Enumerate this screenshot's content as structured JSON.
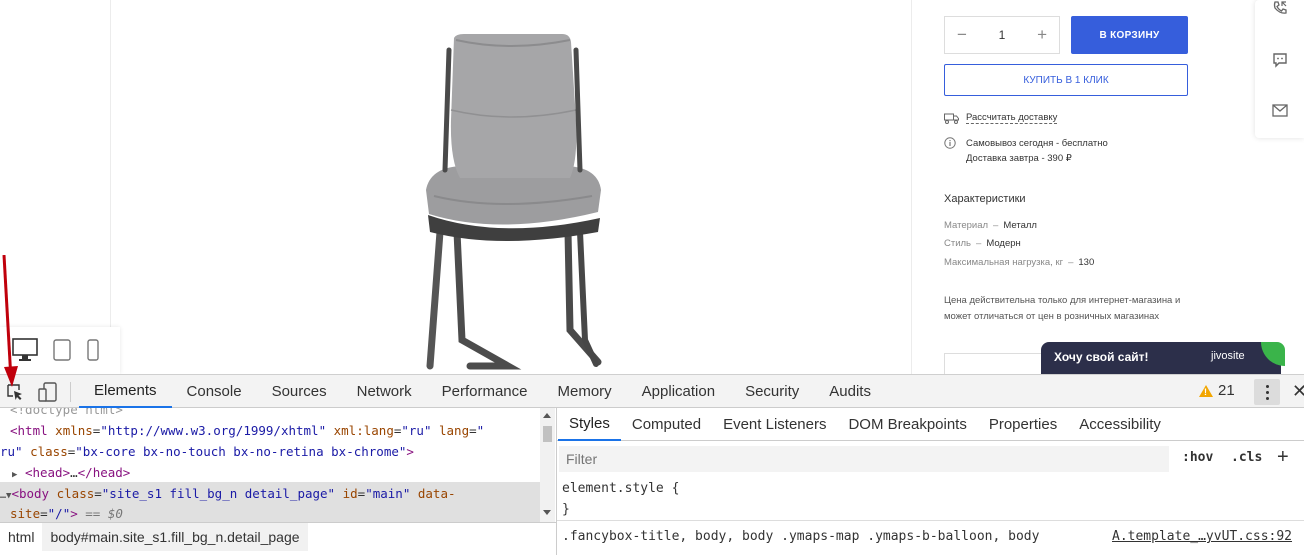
{
  "shop": {
    "quantity": {
      "minus": "−",
      "value": "1",
      "plus": "+"
    },
    "add_to_cart": "В КОРЗИНУ",
    "buy_one_click": "КУПИТЬ В 1 КЛИК",
    "delivery_calc": "Рассчитать доставку",
    "pickup": "Самовывоз сегодня - бесплатно",
    "delivery_tomorrow": "Доставка завтра - 390 ₽",
    "characteristics_title": "Характеристики",
    "characteristics": [
      {
        "key": "Материал",
        "dash": "–",
        "value": "Металл"
      },
      {
        "key": "Стиль",
        "dash": "–",
        "value": "Модерн"
      },
      {
        "key": "Максимальная нагрузка, кг",
        "dash": "–",
        "value": "130"
      }
    ],
    "price_note": "Цена действительна только для интернет-магазина и может отличаться от цен в розничных магазинах",
    "brand_color": "#365edc"
  },
  "jivo": {
    "text": "Хочу свой сайт!",
    "logo": "jivosite"
  },
  "side_icons": [
    "phone-callback-icon",
    "chat-icon",
    "mail-icon"
  ],
  "device_icons": [
    "desktop-icon",
    "tablet-icon",
    "mobile-icon"
  ],
  "devtools": {
    "tabs": [
      "Elements",
      "Console",
      "Sources",
      "Network",
      "Performance",
      "Memory",
      "Application",
      "Security",
      "Audits"
    ],
    "active_tab": "Elements",
    "warnings_count": "21",
    "dom": {
      "doctype": "<!doctype html>",
      "html_open_tag": "<html",
      "html_attr1_name": " xmlns",
      "html_attr1_value": "\"http://www.w3.org/1999/xhtml\"",
      "html_attr2_name": " xml:lang",
      "html_attr2_value": "\"ru\"",
      "html_attr3_name": " lang",
      "html_attr3_value_a": "\"",
      "html_attr3_value_b": "ru\"",
      "html_attr4_name": " class",
      "html_attr4_value": "\"bx-core bx-no-touch bx-no-retina bx-chrome\"",
      "close": ">",
      "head": "<head>",
      "head_ellipsis": "…",
      "head_close": "</head>",
      "body_open": "<body",
      "body_class_name": " class",
      "body_class_value": "\"site_s1  fill_bg_n detail_page\"",
      "body_id_name": " id",
      "body_id_value": "\"main\"",
      "body_data_name_a": " data-",
      "body_data_name_b": "site",
      "body_data_value": "\"/\"",
      "body_close": ">",
      "eq": " == $0",
      "ellipsis": "…",
      "triangle_collapsed": "▶",
      "triangle_expanded": "▼"
    },
    "breadcrumbs": [
      "html",
      "body#main.site_s1.fill_bg_n.detail_page"
    ],
    "styles_tabs": [
      "Styles",
      "Computed",
      "Event Listeners",
      "DOM Breakpoints",
      "Properties",
      "Accessibility"
    ],
    "active_styles_tab": "Styles",
    "filter_placeholder": "Filter",
    "hov": ":hov",
    "cls": ".cls",
    "plus": "+",
    "element_style_open": "element.style {",
    "element_style_close": "}",
    "rule_selector": ".fancybox-title, body, body .ymaps-map .ymaps-b-balloon, body",
    "rule_source": "A.template_…yvUT.css:92"
  }
}
